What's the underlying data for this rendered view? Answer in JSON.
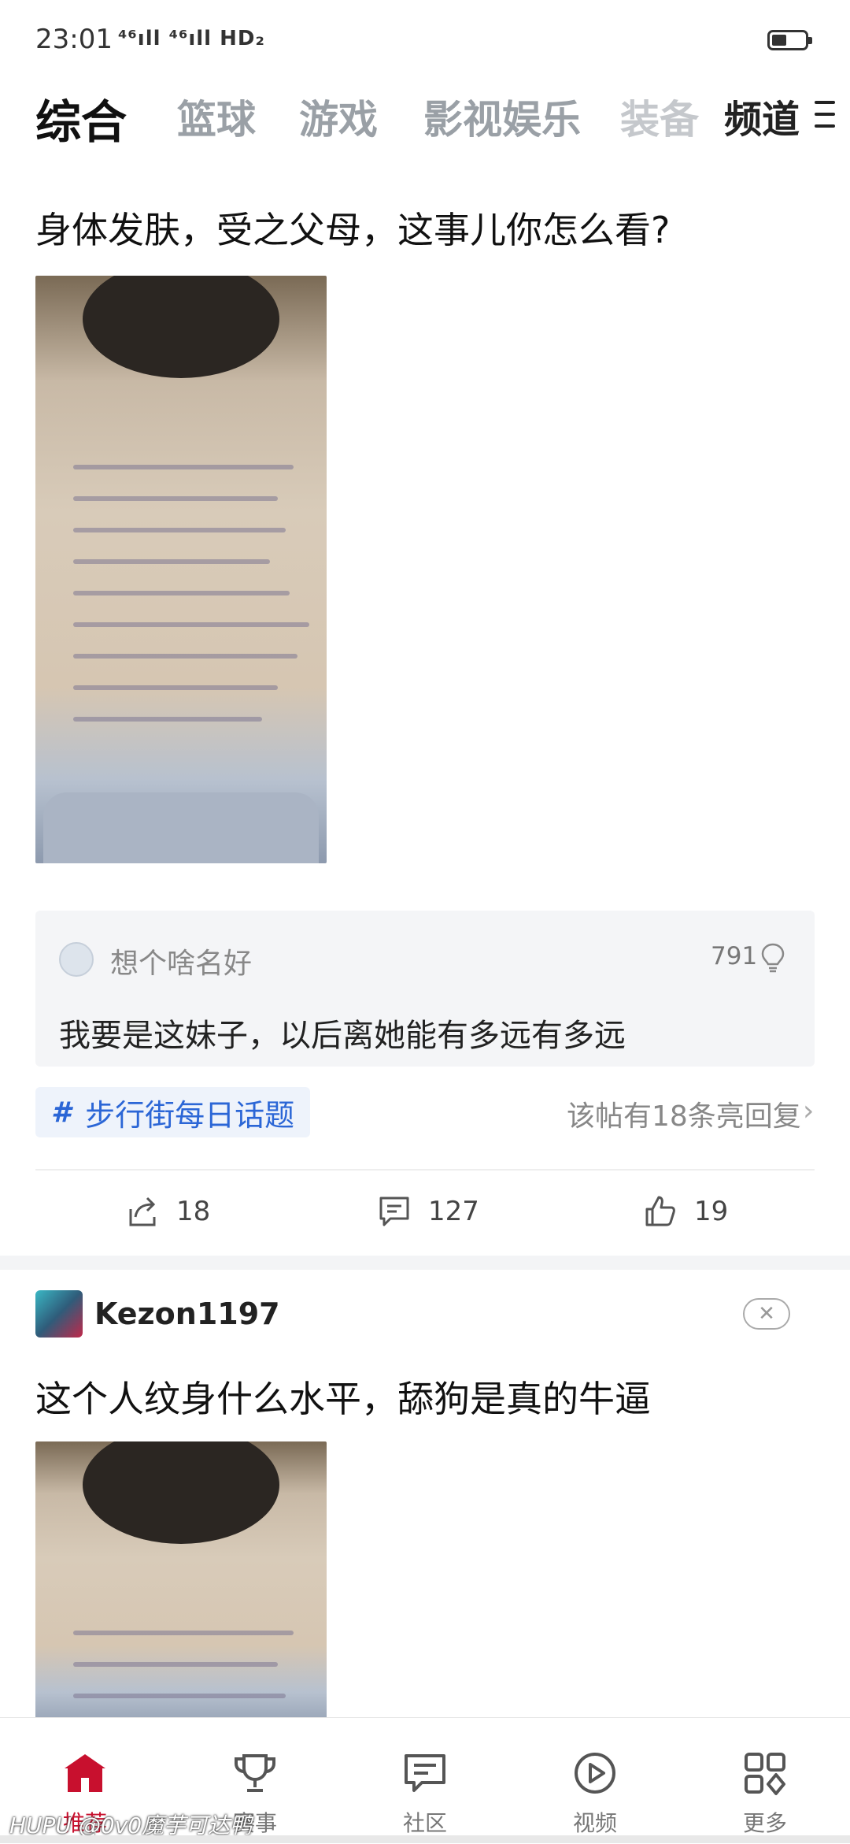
{
  "status_bar": {
    "time": "23:01",
    "signal": "⁴⁶ıll ⁴⁶ıll HD₂",
    "battery_level": 0.45
  },
  "tabs": [
    "综合",
    "篮球",
    "游戏",
    "影视娱乐",
    "装备"
  ],
  "channel_label": "频道",
  "post1": {
    "title": "身体发肤，受之父母，这事儿你怎么看?",
    "top_comment": {
      "user": "想个啥名好",
      "likes": "791",
      "text": "我要是这妹子，以后离她能有多远有多远"
    },
    "topic_tag": "步行街每日话题",
    "highlight_replies": "该帖有18条亮回复",
    "actions": {
      "share": "18",
      "comment": "127",
      "like": "19"
    }
  },
  "post2": {
    "username": "Kezon1197",
    "title": "这个人纹身什么水平，舔狗是真的牛逼"
  },
  "bottom_nav": [
    {
      "label": "推荐",
      "icon": "home-icon",
      "active": true
    },
    {
      "label": "赛事",
      "icon": "trophy-icon",
      "active": false
    },
    {
      "label": "社区",
      "icon": "message-icon",
      "active": false
    },
    {
      "label": "视频",
      "icon": "play-icon",
      "active": false
    },
    {
      "label": "更多",
      "icon": "grid-icon",
      "active": false
    }
  ],
  "watermark": "HUPU @0v0魔芋可达鸭",
  "colors": {
    "accent": "#c8102e",
    "link": "#2b66d6",
    "card_bg": "#f4f5f7"
  }
}
